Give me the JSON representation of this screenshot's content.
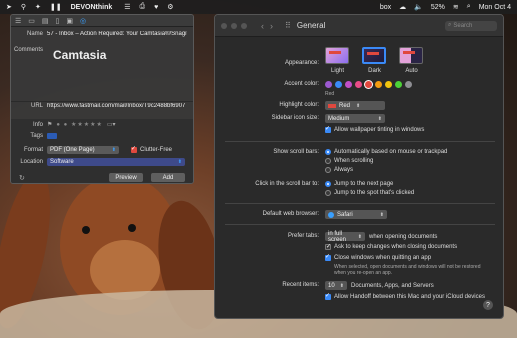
{
  "menubar": {
    "app_name": "DEVONthink",
    "status_right": [
      "box",
      "52%",
      "Mon Oct 4"
    ]
  },
  "clipper": {
    "name_label": "Name",
    "name_value": "57 - Inbox – Action Required: Your Camtasia®/Snagit®",
    "comments_label": "Comments",
    "notes_preview": "Camtasia",
    "url_label": "URL",
    "url_value": "https://www.fastmail.com/mail/Inbox/T9c2488bf6907",
    "info_label": "Info",
    "tags_label": "Tags",
    "format_label": "Format",
    "format_value": "PDF (One Page)",
    "clutter_free_label": "Clutter-Free",
    "location_label": "Location",
    "location_value": "Software",
    "preview_button": "Preview",
    "add_button": "Add"
  },
  "prefs": {
    "window_title": "General",
    "search_placeholder": "Search",
    "appearance_label": "Appearance:",
    "appearance_options": [
      "Light",
      "Dark",
      "Auto"
    ],
    "accent_label": "Accent color:",
    "accent_selected_name": "Red",
    "accent_colors": [
      "#9b59d0",
      "#3a8af7",
      "#c04fc8",
      "#e84c88",
      "#e0483e",
      "#f39c12",
      "#f1c40f",
      "#4cd137",
      "#8e8e93"
    ],
    "highlight_label": "Highlight color:",
    "highlight_value": "Red",
    "sidebar_icon_label": "Sidebar icon size:",
    "sidebar_icon_value": "Medium",
    "wallpaper_tinting_label": "Allow wallpaper tinting in windows",
    "scroll_bars_label": "Show scroll bars:",
    "scroll_options": [
      "Automatically based on mouse or trackpad",
      "When scrolling",
      "Always"
    ],
    "click_scroll_label": "Click in the scroll bar to:",
    "click_options": [
      "Jump to the next page",
      "Jump to the spot that's clicked"
    ],
    "browser_label": "Default web browser:",
    "browser_value": "Safari",
    "prefer_tabs_label": "Prefer tabs:",
    "prefer_tabs_value": "in full screen",
    "prefer_tabs_suffix": "when opening documents",
    "ask_keep_changes": "Ask to keep changes when closing documents",
    "close_windows": "Close windows when quitting an app",
    "close_windows_note": "When selected, open documents and windows will not be restored when you re-open an app.",
    "recent_items_label": "Recent items:",
    "recent_items_value": "10",
    "recent_items_suffix": "Documents, Apps, and Servers",
    "handoff_label": "Allow Handoff between this Mac and your iCloud devices",
    "help_glyph": "?"
  }
}
